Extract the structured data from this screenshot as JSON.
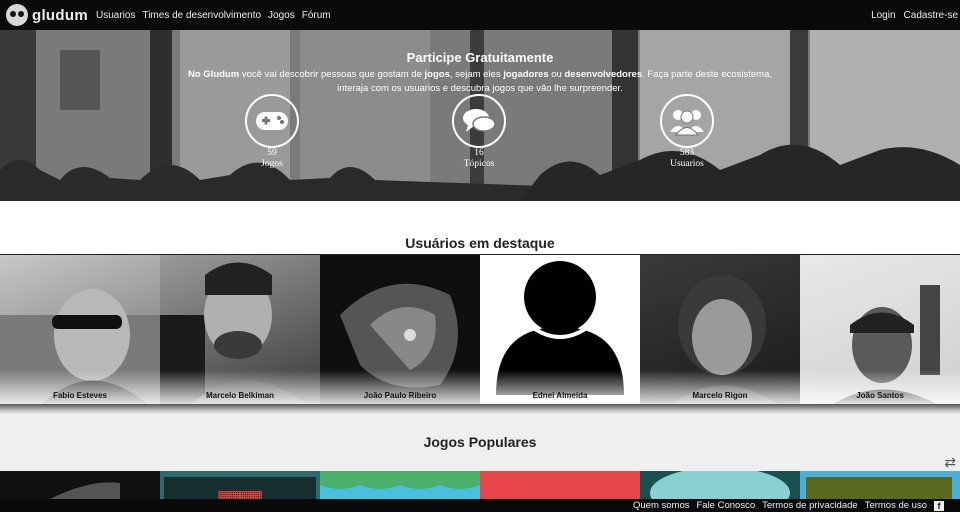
{
  "header": {
    "logo_text": "gludum",
    "nav": [
      "Usuarios",
      "Times de desenvolvimento",
      "Jogos",
      "Fórum"
    ],
    "login": "Login",
    "signup": "Cadastre-se"
  },
  "hero": {
    "title": "Participe Gratuitamente",
    "desc_part1": "No Gludum",
    "desc_part2": " você vai descobrir pessoas que gostam de ",
    "desc_part3": "jogos",
    "desc_part4": ", sejam eles ",
    "desc_part5": "jogadores",
    "desc_part6": " ou ",
    "desc_part7": "desenvolvedores",
    "desc_part8": ". Faça parte deste ecosistema, interaja com os usuarios e descubra jogos que vão lhe surpreender.",
    "stats": [
      {
        "icon": "gamepad-icon",
        "value": "59",
        "label": "Jogos"
      },
      {
        "icon": "chat-bubbles-icon",
        "value": "16",
        "label": "Tópicos"
      },
      {
        "icon": "users-group-icon",
        "value": "583",
        "label": "Usuarios"
      }
    ]
  },
  "featured_users": {
    "title": "Usuários em destaque",
    "users": [
      {
        "name": "Fabio Esteves"
      },
      {
        "name": "Marcelo Belkiman"
      },
      {
        "name": "João Paulo Ribeiro"
      },
      {
        "name": "Ednei Almeida"
      },
      {
        "name": "Marcelo Rigon"
      },
      {
        "name": "João Santos"
      }
    ]
  },
  "popular_games": {
    "title": "Jogos Populares",
    "swap_icon": "swap-arrows-icon",
    "tile_colors": [
      "#111111",
      "#2f6a6a",
      "#4ab06a",
      "#e8454a",
      "#8ad0d0",
      "#4ab0d8"
    ]
  },
  "footer": {
    "links": [
      "Quem somos",
      "Fale Conosco",
      "Termos de privacidade",
      "Termos de uso"
    ],
    "facebook_icon": "facebook-icon"
  }
}
